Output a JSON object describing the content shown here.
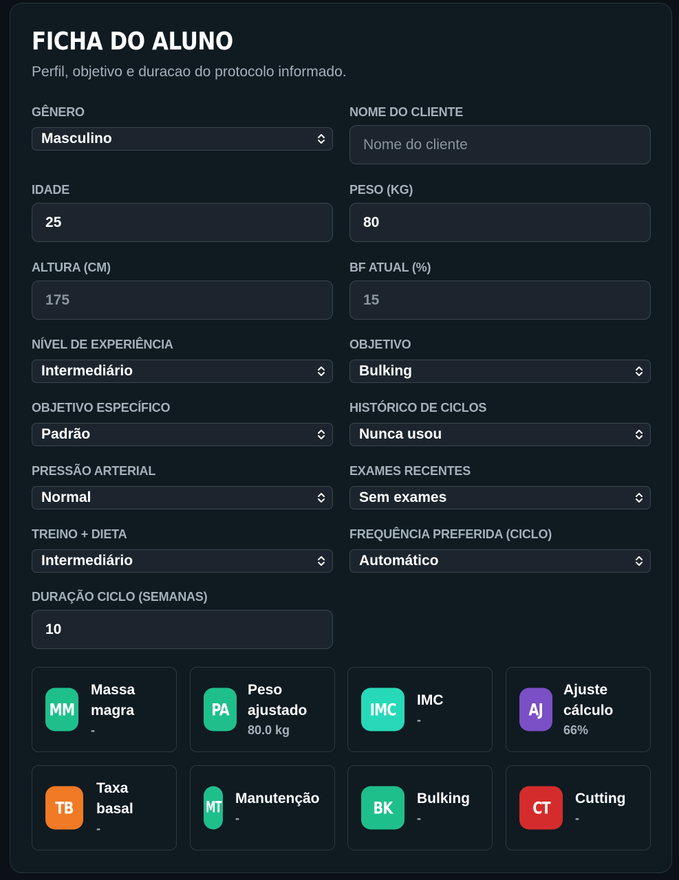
{
  "form": {
    "title": "FICHA DO ALUNO",
    "subtitle": "Perfil, objetivo e duracao do protocolo informado.",
    "fields": {
      "genero": {
        "label": "GÊNERO",
        "value": "Masculino"
      },
      "nome": {
        "label": "NOME DO CLIENTE",
        "placeholder": "Nome do cliente"
      },
      "idade": {
        "label": "IDADE",
        "value": "25"
      },
      "peso": {
        "label": "PESO (KG)",
        "value": "80"
      },
      "altura": {
        "label": "ALTURA (CM)",
        "value": "175"
      },
      "bf": {
        "label": "BF ATUAL (%)",
        "value": "15"
      },
      "nivel": {
        "label": "NÍVEL DE EXPERIÊNCIA",
        "value": "Intermediário"
      },
      "objetivo": {
        "label": "OBJETIVO",
        "value": "Bulking"
      },
      "objetivo_especifico": {
        "label": "OBJETIVO ESPECÍFICO",
        "value": "Padrão"
      },
      "historico": {
        "label": "HISTÓRICO DE CICLOS",
        "value": "Nunca usou"
      },
      "pressao": {
        "label": "PRESSÃO ARTERIAL",
        "value": "Normal"
      },
      "exames": {
        "label": "EXAMES RECENTES",
        "value": "Sem exames"
      },
      "treino": {
        "label": "TREINO + DIETA",
        "value": "Intermediário"
      },
      "frequencia": {
        "label": "FREQUÊNCIA PREFERIDA (CICLO)",
        "value": "Automático"
      },
      "duracao": {
        "label": "DURAÇÃO CICLO (SEMANAS)",
        "value": "10"
      }
    }
  },
  "stats": [
    {
      "badge": "MM",
      "name1": "Massa",
      "name2": "magra",
      "value": "-",
      "color": "#1fbf8c"
    },
    {
      "badge": "PA",
      "name1": "Peso",
      "name2": "ajustado",
      "value": "80.0 kg",
      "color": "#1fbf8c"
    },
    {
      "badge": "IMC",
      "name1": "IMC",
      "name2": "",
      "value": "-",
      "color": "#27d9b8"
    },
    {
      "badge": "AJ",
      "name1": "Ajuste",
      "name2": "cálculo",
      "value": "66%",
      "color": "#7b4fc6"
    },
    {
      "badge": "TB",
      "name1": "Taxa",
      "name2": "basal",
      "value": "-",
      "color": "#f07a25"
    },
    {
      "badge": "MT",
      "name1": "Manutenção",
      "name2": "",
      "value": "-",
      "color": "#1fbf8c"
    },
    {
      "badge": "BK",
      "name1": "Bulking",
      "name2": "",
      "value": "-",
      "color": "#1fbf8c"
    },
    {
      "badge": "CT",
      "name1": "Cutting",
      "name2": "",
      "value": "-",
      "color": "#d42c2c"
    }
  ]
}
